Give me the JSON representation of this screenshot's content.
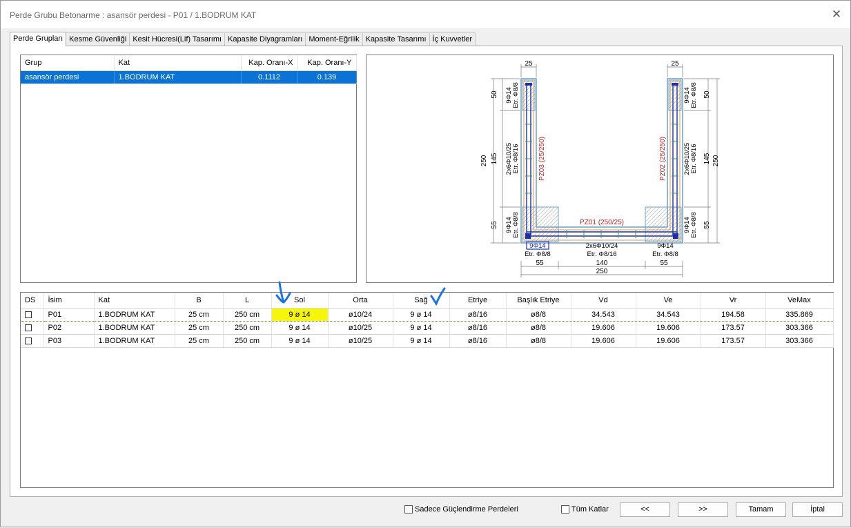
{
  "window": {
    "title": "Perde Grubu Betonarme  :  asansör perdesi - P01 / 1.BODRUM KAT",
    "close_symbol": "✕"
  },
  "tabs": [
    {
      "label": "Perde Grupları",
      "active": true
    },
    {
      "label": "Kesme Güvenliği"
    },
    {
      "label": "Kesit Hücresi(Lif) Tasarımı"
    },
    {
      "label": "Kapasite Diyagramları"
    },
    {
      "label": "Moment-Eğrilik"
    },
    {
      "label": "Kapasite Tasarımı"
    },
    {
      "label": "İç Kuvvetler"
    }
  ],
  "group_table": {
    "headers": [
      "Grup",
      "Kat",
      "Kap. Oranı-X",
      "Kap. Oranı-Y"
    ],
    "rows": [
      [
        "asansör perdesi",
        "1.BODRUM KAT",
        "0.1112",
        "0.139"
      ]
    ]
  },
  "drawing": {
    "top_dims": [
      "25",
      "25"
    ],
    "left_dims": [
      "50",
      "145",
      "55"
    ],
    "left_total": "250",
    "right_dims": [
      "50",
      "145",
      "55"
    ],
    "right_total": "250",
    "bottom_dims": [
      "55",
      "140",
      "55"
    ],
    "bottom_total": "250",
    "labels": {
      "pz01": "PZ01 (250/25)",
      "pz02": "PZ02 (25/250)",
      "pz03": "PZ03 (25/250)",
      "left_top_bar": "9Φ14",
      "left_top_stir": "Etr. Φ8/8",
      "left_mid_bar": "2x6Φ10/25",
      "left_mid_stir": "Etr. Φ8/16",
      "left_bot_bar": "9Φ14",
      "left_bot_stir": "Etr. Φ8/8",
      "right_top_bar": "9Φ14",
      "right_top_stir": "Etr. Φ8/8",
      "right_mid_bar": "2x6Φ10/25",
      "right_mid_stir": "Etr. Φ8/16",
      "right_bot_bar": "9Φ14",
      "right_bot_stir": "Etr. Φ8/8",
      "bot_left_bar": "9Φ14",
      "bot_left_stir": "Etr. Φ8/8",
      "bot_mid_bar": "2x6Φ10/24",
      "bot_mid_stir": "Etr. Φ8/16",
      "bot_right_bar": "9Φ14",
      "bot_right_stir": "Etr. Φ8/8"
    }
  },
  "wall_table": {
    "headers": [
      "DS",
      "İsim",
      "Kat",
      "B",
      "L",
      "Sol",
      "Orta",
      "Sağ",
      "Etriye",
      "Başlık Etriye",
      "Vd",
      "Ve",
      "Vr",
      "VeMax"
    ],
    "rows": [
      [
        "",
        "P01",
        "1.BODRUM KAT",
        "25 cm",
        "250 cm",
        "9 ø 14",
        "ø10/24",
        "9 ø 14",
        "ø8/16",
        "ø8/8",
        "34.543",
        "34.543",
        "194.58",
        "335.869"
      ],
      [
        "",
        "P02",
        "1.BODRUM KAT",
        "25 cm",
        "250 cm",
        "9 ø 14",
        "ø10/25",
        "9 ø 14",
        "ø8/16",
        "ø8/8",
        "19.606",
        "19.606",
        "173.57",
        "303.366"
      ],
      [
        "",
        "P03",
        "1.BODRUM KAT",
        "25 cm",
        "250 cm",
        "9 ø 14",
        "ø10/25",
        "9 ø 14",
        "ø8/16",
        "ø8/8",
        "19.606",
        "19.606",
        "173.57",
        "303.366"
      ]
    ]
  },
  "footer": {
    "only_strengthening": "Sadece Güçlendirme Perdeleri",
    "all_floors": "Tüm Katlar",
    "prev": "<<",
    "next": ">>",
    "ok": "Tamam",
    "cancel": "İptal"
  },
  "colors": {
    "selection": "#0a74d6",
    "highlight": "#f6f60a",
    "annotation_arrow": "#1a73e8",
    "drawing_red": "#cc2020",
    "drawing_blue": "#1a2fb0"
  }
}
